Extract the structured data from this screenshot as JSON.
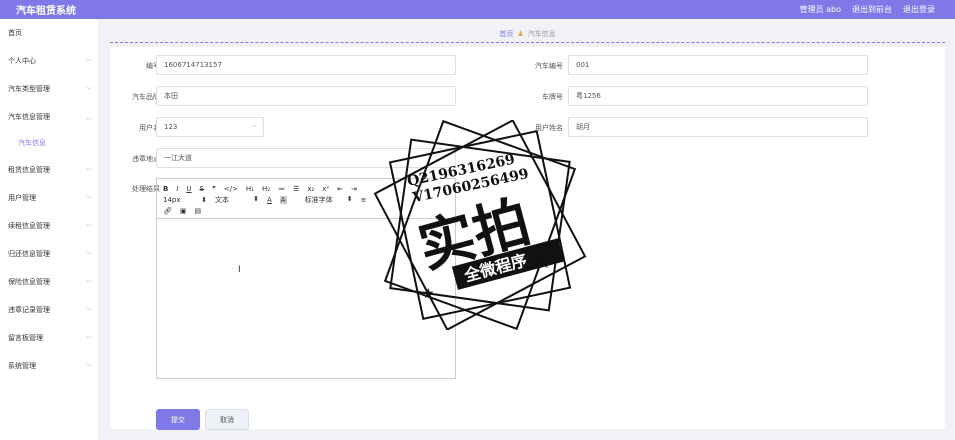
{
  "app": {
    "title": "汽车租赁系统"
  },
  "header": {
    "admin_label": "管理员 abo",
    "back_label": "退出到前台",
    "logout_label": "退出登录"
  },
  "sidebar": {
    "items": [
      {
        "label": "首页"
      },
      {
        "label": "个人中心"
      },
      {
        "label": "汽车类型管理"
      },
      {
        "label": "汽车信息管理"
      },
      {
        "label": "汽车信息"
      },
      {
        "label": "租赁信息管理"
      },
      {
        "label": "用户管理"
      },
      {
        "label": "续租信息管理"
      },
      {
        "label": "归还信息管理"
      },
      {
        "label": "保险信息管理"
      },
      {
        "label": "违章记录管理"
      },
      {
        "label": "留言板管理"
      },
      {
        "label": "系统管理"
      }
    ]
  },
  "breadcrumb": {
    "home": "首页",
    "current": "汽车信息"
  },
  "form": {
    "id_label": "编号",
    "id_value": "1606714713157",
    "car_no_label": "汽车编号",
    "car_no_value": "001",
    "brand_label": "汽车品牌",
    "brand_value": "本田",
    "plate_label": "车牌号",
    "plate_value": "粤1256",
    "username_label": "用户名",
    "username_value": "123",
    "realname_label": "用户姓名",
    "realname_value": "胡月",
    "location_label": "违章地点",
    "location_value": "一江大道",
    "result_label": "处理结果"
  },
  "editor": {
    "font_size": "14px",
    "block_type": "文本",
    "font_family": "标准字体",
    "row1": [
      "B",
      "I",
      "U",
      "S",
      "❞",
      "</>",
      "H₁",
      "H₂",
      "≔",
      "☰",
      "x₂",
      "x²",
      "⇤",
      "⇥"
    ]
  },
  "buttons": {
    "submit": "提交",
    "cancel": "取消"
  },
  "watermark": {
    "line1": "Q2196316269",
    "line2": "V17060256499",
    "main": "实拍",
    "sub": "全微程序"
  },
  "colors": {
    "accent": "#7f79e8"
  }
}
